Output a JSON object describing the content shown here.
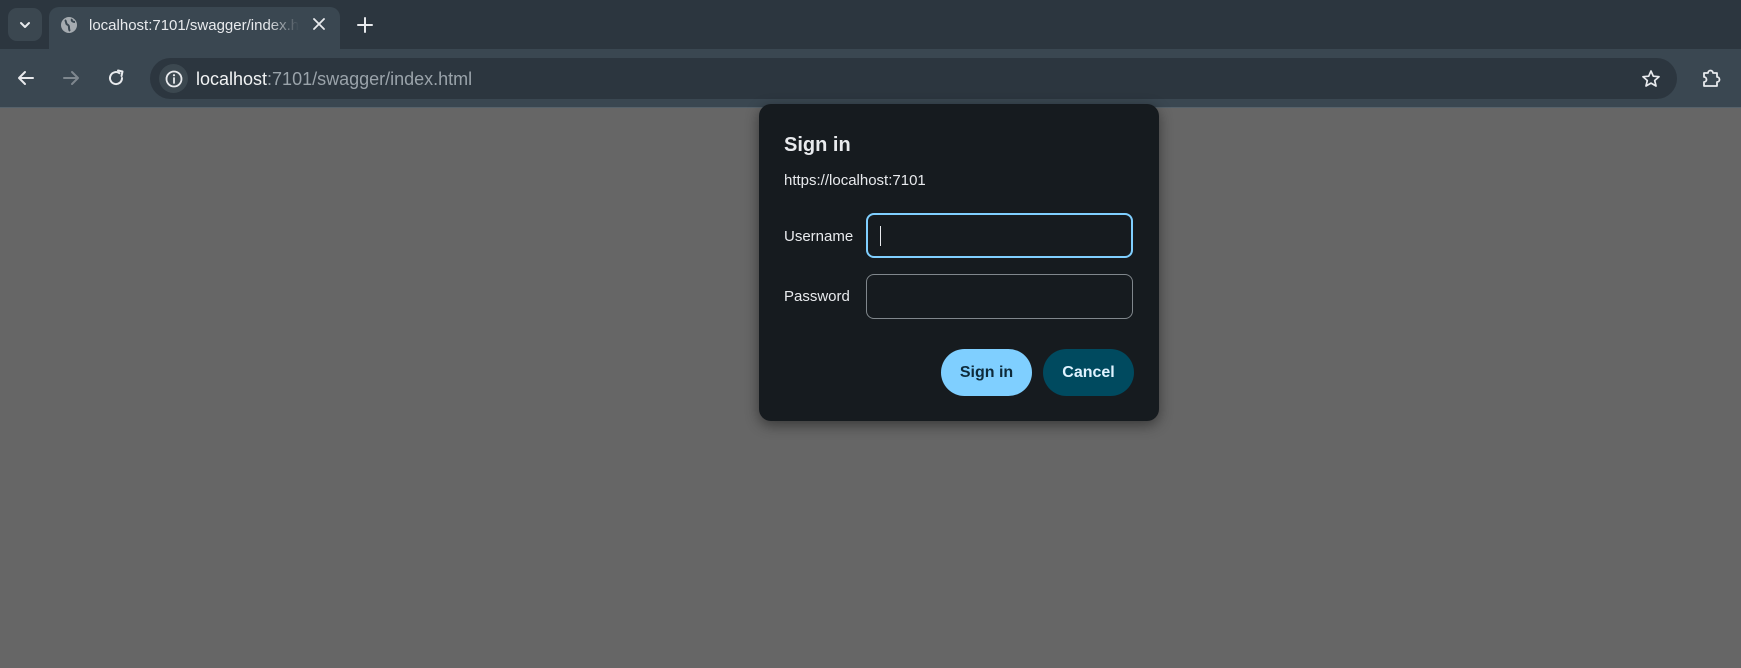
{
  "browser": {
    "tab": {
      "title": "localhost:7101/swagger/index.html"
    },
    "address_bar": {
      "host": "localhost",
      "path": ":7101/swagger/index.html"
    },
    "icons": {
      "tab_search": "chevron-down-icon",
      "favicon": "globe-icon",
      "close_tab": "close-icon",
      "new_tab": "plus-icon",
      "back": "arrow-left-icon",
      "forward": "arrow-right-icon",
      "reload": "reload-icon",
      "site_info": "info-icon",
      "bookmark": "star-icon",
      "extensions": "puzzle-icon"
    }
  },
  "dialog": {
    "title": "Sign in",
    "origin": "https://localhost:7101",
    "username_label": "Username",
    "username_value": "",
    "password_label": "Password",
    "password_value": "",
    "sign_in_label": "Sign in",
    "cancel_label": "Cancel"
  },
  "colors": {
    "page_overlay": "#666666",
    "dialog_bg": "#161b1f",
    "accent": "#7fcfff",
    "secondary_button": "#004a5f"
  }
}
